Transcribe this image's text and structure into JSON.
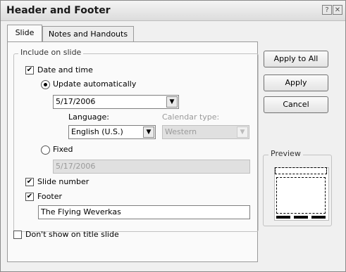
{
  "window": {
    "title": "Header and Footer",
    "help_glyph": "?",
    "close_glyph": "✕"
  },
  "tabs": [
    {
      "label": "Slide",
      "active": true
    },
    {
      "label": "Notes and Handouts",
      "active": false
    }
  ],
  "include_group": {
    "legend": "Include on slide",
    "date_time": {
      "label": "Date and time",
      "checked": true,
      "update_auto": {
        "label": "Update automatically",
        "selected": true,
        "value": "5/17/2006"
      },
      "language": {
        "label": "Language:",
        "value": "English (U.S.)"
      },
      "calendar_type": {
        "label": "Calendar type:",
        "value": "Western",
        "disabled": true
      },
      "fixed": {
        "label": "Fixed",
        "selected": false,
        "value": "5/17/2006"
      }
    },
    "slide_number": {
      "label": "Slide number",
      "checked": true
    },
    "footer": {
      "label": "Footer",
      "checked": true,
      "value": "The Flying Weverkas"
    }
  },
  "dont_show_title": {
    "label": "Don't show on title slide",
    "checked": false
  },
  "buttons": {
    "apply_all": "Apply to All",
    "apply": "Apply",
    "cancel": "Cancel"
  },
  "preview": {
    "label": "Preview"
  }
}
